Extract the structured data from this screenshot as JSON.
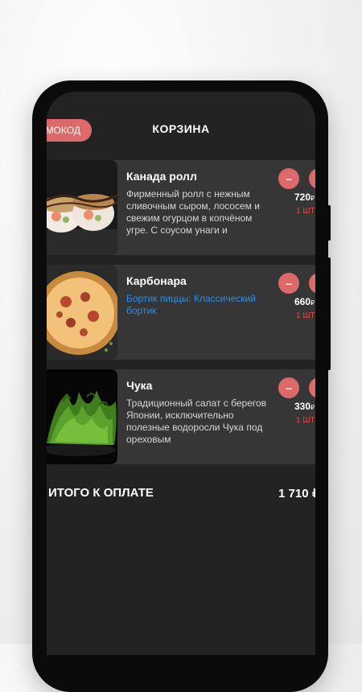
{
  "header": {
    "promo_label": "ПРОМОКОД",
    "title": "КОРЗИНА"
  },
  "cart": {
    "items": [
      {
        "name": "Канада ролл",
        "description": "Фирменный ролл с нежным сливочным сыром, лососем и свежим огурцом в копчёном угре. С соусом унаги и",
        "description_color": "#d6d6d6",
        "minus_label": "–",
        "price": "720",
        "currency": "₽",
        "quantity": "1 ШТ"
      },
      {
        "name": "Карбонара",
        "description": "Бортик пиццы: Классический бортик",
        "description_color": "#2f8de4",
        "minus_label": "–",
        "price": "660",
        "currency": "₽",
        "quantity": "1 ШТ"
      },
      {
        "name": "Чука",
        "description": "Традиционный салат с берегов Японии, исключительно полезные водоросли Чука под ореховым",
        "description_color": "#d6d6d6",
        "minus_label": "–",
        "price": "330",
        "currency": "₽",
        "quantity": "1 ШТ"
      }
    ]
  },
  "total": {
    "label": "ИТОГО К ОПЛАТЕ",
    "value": "1 710 ₽"
  },
  "colors": {
    "accent": "#dd6a6a",
    "background": "#232323",
    "card": "#363636",
    "quantity": "#e04848",
    "option_text": "#2f8de4"
  },
  "icons": [
    "minus-icon",
    "plus-icon",
    "wifi-icon"
  ]
}
